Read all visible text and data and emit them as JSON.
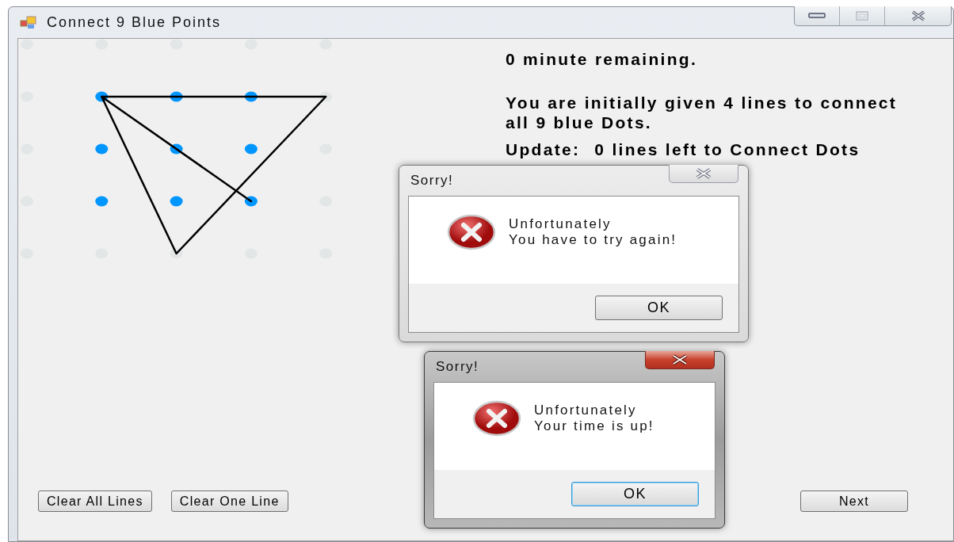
{
  "window": {
    "title": "Connect 9 Blue Points"
  },
  "board": {
    "rows": [
      {
        "dots": [
          {
            "active": false
          },
          {
            "active": false
          },
          {
            "active": false
          },
          {
            "active": false
          },
          {
            "active": false
          }
        ]
      },
      {
        "dots": [
          {
            "active": false
          },
          {
            "active": true
          },
          {
            "active": true
          },
          {
            "active": true
          },
          {
            "active": false
          }
        ]
      },
      {
        "dots": [
          {
            "active": false
          },
          {
            "active": true
          },
          {
            "active": true
          },
          {
            "active": true
          },
          {
            "active": false
          }
        ]
      },
      {
        "dots": [
          {
            "active": false
          },
          {
            "active": true
          },
          {
            "active": true
          },
          {
            "active": true
          },
          {
            "active": false
          }
        ]
      },
      {
        "dots": [
          {
            "active": false
          },
          {
            "active": false
          },
          {
            "active": false
          },
          {
            "active": false
          },
          {
            "active": false
          }
        ]
      }
    ]
  },
  "status": {
    "time": "0 minute remaining.",
    "instructions": "You are initially given 4 lines to connect all 9 blue Dots.",
    "update_label": "Update:",
    "update_text": "0 lines left to Connect Dots"
  },
  "buttons": [
    {
      "label": "Clear All Lines",
      "kind": "left"
    },
    {
      "label": "Clear One Line",
      "kind": "left"
    },
    {
      "label": "Next",
      "kind": "right"
    }
  ],
  "dialogs": [
    {
      "title": "Sorry!",
      "lines": [
        "Unfortunately",
        "You have to try again!"
      ],
      "button": "OK",
      "active": false
    },
    {
      "title": "Sorry!",
      "lines": [
        "Unfortunately",
        "Your time is up!"
      ],
      "button": "OK",
      "active": true
    }
  ]
}
